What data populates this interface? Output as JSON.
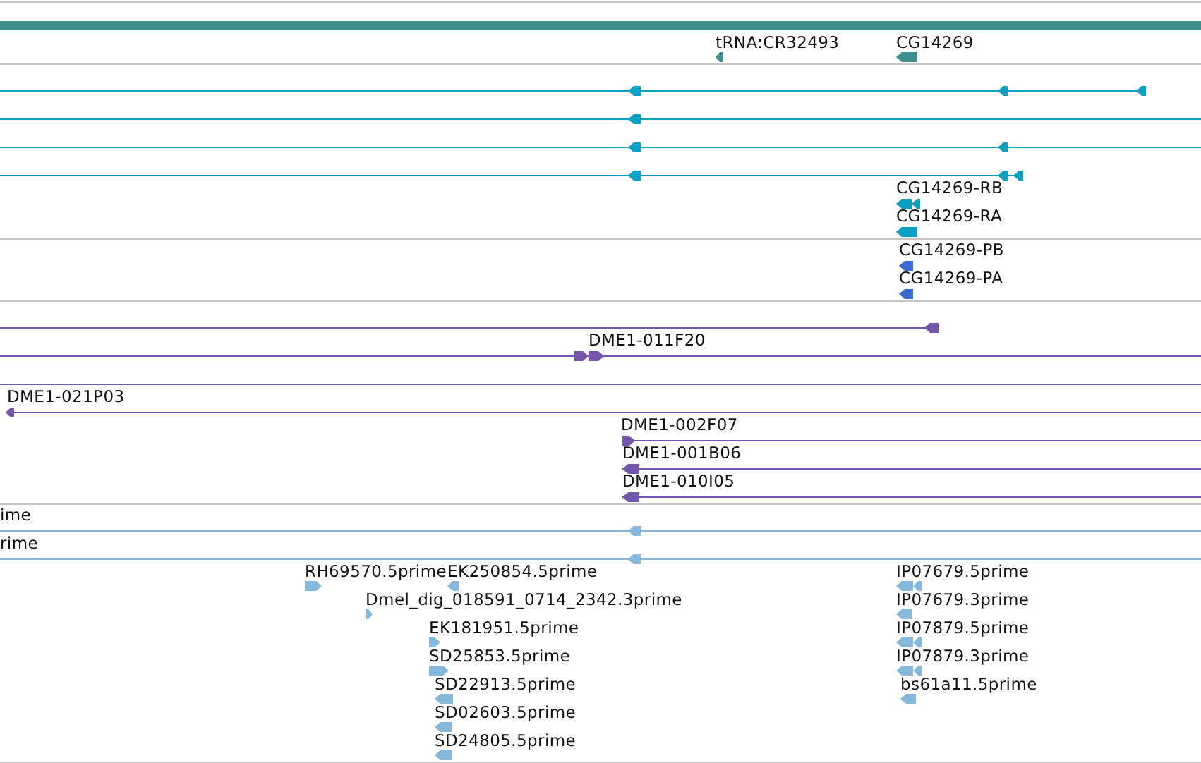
{
  "tracks": [
    {
      "color": "#3f8f8f",
      "features": [
        {
          "kind": "block",
          "label": "tRNA:CR32493",
          "reverse": true
        },
        {
          "kind": "block",
          "label": "CG14269",
          "reverse": true
        }
      ]
    },
    {
      "color": "#0aa0c4",
      "features": [
        {
          "kind": "line",
          "reverse": true
        },
        {
          "kind": "line",
          "reverse": true
        },
        {
          "kind": "line",
          "reverse": true
        },
        {
          "kind": "line",
          "reverse": true
        },
        {
          "kind": "block",
          "label": "CG14269-RB",
          "reverse": true
        },
        {
          "kind": "block",
          "label": "CG14269-RA",
          "reverse": true
        }
      ]
    },
    {
      "color": "#3a6acc",
      "features": [
        {
          "kind": "block",
          "label": "CG14269-PB",
          "reverse": true
        },
        {
          "kind": "block",
          "label": "CG14269-PA",
          "reverse": true
        }
      ]
    },
    {
      "color": "#7556ad",
      "features": [
        {
          "kind": "line",
          "reverse": true
        },
        {
          "kind": "line",
          "label": "DME1-011F20",
          "reverse": false
        },
        {
          "kind": "line"
        },
        {
          "kind": "line",
          "label": "DME1-021P03",
          "reverse": true
        },
        {
          "kind": "line",
          "label": "DME1-002F07",
          "reverse": false
        },
        {
          "kind": "line",
          "label": "DME1-001B06",
          "reverse": true
        },
        {
          "kind": "line",
          "label": "DME1-010I05",
          "reverse": true
        }
      ]
    },
    {
      "color": "#86b8dc",
      "features": [
        {
          "kind": "line",
          "label": "ime",
          "reverse": true
        },
        {
          "kind": "line",
          "label": "rime",
          "reverse": true
        },
        {
          "kind": "block",
          "label": "RH69570.5prime",
          "reverse": false
        },
        {
          "kind": "block",
          "label": "EK250854.5prime",
          "reverse": true
        },
        {
          "kind": "block",
          "label": "Dmel_dig_018591_0714_2342.3prime",
          "reverse": false
        },
        {
          "kind": "block",
          "label": "EK181951.5prime",
          "reverse": false
        },
        {
          "kind": "block",
          "label": "SD25853.5prime",
          "reverse": false
        },
        {
          "kind": "block",
          "label": "SD22913.5prime",
          "reverse": true
        },
        {
          "kind": "block",
          "label": "SD02603.5prime",
          "reverse": true
        },
        {
          "kind": "block",
          "label": "SD24805.5prime",
          "reverse": true
        },
        {
          "kind": "block",
          "label": "IP07679.5prime",
          "reverse": true
        },
        {
          "kind": "block",
          "label": "IP07679.3prime",
          "reverse": true
        },
        {
          "kind": "block",
          "label": "IP07879.5prime",
          "reverse": true
        },
        {
          "kind": "block",
          "label": "IP07879.3prime",
          "reverse": true
        },
        {
          "kind": "block",
          "label": "bs61a11.5prime",
          "reverse": true
        }
      ]
    }
  ]
}
